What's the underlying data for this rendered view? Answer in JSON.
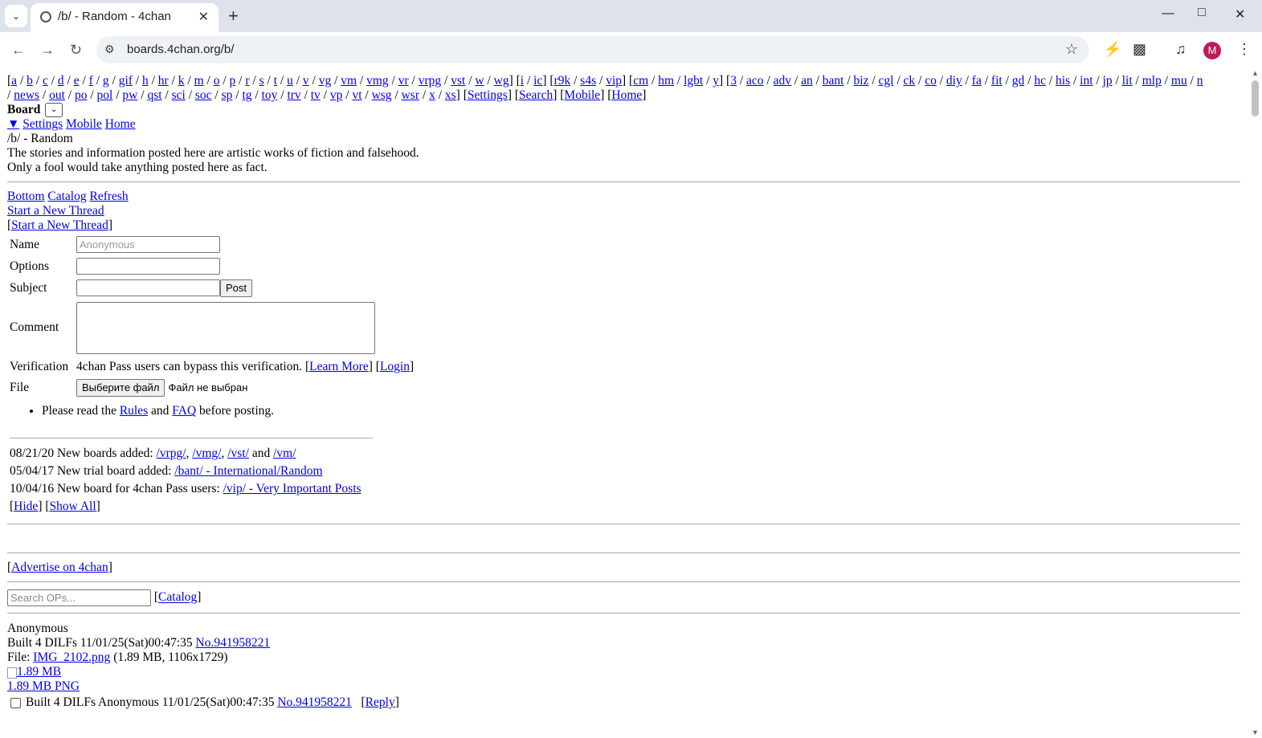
{
  "browser": {
    "tab_title": "/b/ - Random - 4chan",
    "url": "boards.4chan.org/b/",
    "avatar_letter": "M"
  },
  "boardnav": {
    "line1": [
      {
        "t": "[",
        "l": false
      },
      {
        "t": "a",
        "l": true
      },
      {
        "t": " / ",
        "l": false
      },
      {
        "t": "b",
        "l": true
      },
      {
        "t": " / ",
        "l": false
      },
      {
        "t": "c",
        "l": true
      },
      {
        "t": " / ",
        "l": false
      },
      {
        "t": "d",
        "l": true
      },
      {
        "t": " / ",
        "l": false
      },
      {
        "t": "e",
        "l": true
      },
      {
        "t": " / ",
        "l": false
      },
      {
        "t": "f",
        "l": true
      },
      {
        "t": " / ",
        "l": false
      },
      {
        "t": "g",
        "l": true
      },
      {
        "t": " / ",
        "l": false
      },
      {
        "t": "gif",
        "l": true
      },
      {
        "t": " / ",
        "l": false
      },
      {
        "t": "h",
        "l": true
      },
      {
        "t": " / ",
        "l": false
      },
      {
        "t": "hr",
        "l": true
      },
      {
        "t": " / ",
        "l": false
      },
      {
        "t": "k",
        "l": true
      },
      {
        "t": " / ",
        "l": false
      },
      {
        "t": "m",
        "l": true
      },
      {
        "t": " / ",
        "l": false
      },
      {
        "t": "o",
        "l": true
      },
      {
        "t": " / ",
        "l": false
      },
      {
        "t": "p",
        "l": true
      },
      {
        "t": " / ",
        "l": false
      },
      {
        "t": "r",
        "l": true
      },
      {
        "t": " / ",
        "l": false
      },
      {
        "t": "s",
        "l": true
      },
      {
        "t": " / ",
        "l": false
      },
      {
        "t": "t",
        "l": true
      },
      {
        "t": " / ",
        "l": false
      },
      {
        "t": "u",
        "l": true
      },
      {
        "t": " / ",
        "l": false
      },
      {
        "t": "v",
        "l": true
      },
      {
        "t": " / ",
        "l": false
      },
      {
        "t": "vg",
        "l": true
      },
      {
        "t": " / ",
        "l": false
      },
      {
        "t": "vm",
        "l": true
      },
      {
        "t": " / ",
        "l": false
      },
      {
        "t": "vmg",
        "l": true
      },
      {
        "t": " / ",
        "l": false
      },
      {
        "t": "vr",
        "l": true
      },
      {
        "t": " / ",
        "l": false
      },
      {
        "t": "vrpg",
        "l": true
      },
      {
        "t": " / ",
        "l": false
      },
      {
        "t": "vst",
        "l": true
      },
      {
        "t": " / ",
        "l": false
      },
      {
        "t": "w",
        "l": true
      },
      {
        "t": " / ",
        "l": false
      },
      {
        "t": "wg",
        "l": true
      },
      {
        "t": "] [",
        "l": false
      },
      {
        "t": "i",
        "l": true
      },
      {
        "t": " / ",
        "l": false
      },
      {
        "t": "ic",
        "l": true
      },
      {
        "t": "] [",
        "l": false
      },
      {
        "t": "r9k",
        "l": true
      },
      {
        "t": " / ",
        "l": false
      },
      {
        "t": "s4s",
        "l": true
      },
      {
        "t": " / ",
        "l": false
      },
      {
        "t": "vip",
        "l": true
      },
      {
        "t": "] [",
        "l": false
      },
      {
        "t": "cm",
        "l": true
      },
      {
        "t": " / ",
        "l": false
      },
      {
        "t": "hm",
        "l": true
      },
      {
        "t": " / ",
        "l": false
      },
      {
        "t": "lgbt",
        "l": true
      },
      {
        "t": " / ",
        "l": false
      },
      {
        "t": "y",
        "l": true
      },
      {
        "t": "] [",
        "l": false
      },
      {
        "t": "3",
        "l": true
      },
      {
        "t": " / ",
        "l": false
      },
      {
        "t": "aco",
        "l": true
      },
      {
        "t": " / ",
        "l": false
      },
      {
        "t": "adv",
        "l": true
      },
      {
        "t": " / ",
        "l": false
      },
      {
        "t": "an",
        "l": true
      },
      {
        "t": " / ",
        "l": false
      },
      {
        "t": "bant",
        "l": true
      },
      {
        "t": " / ",
        "l": false
      },
      {
        "t": "biz",
        "l": true
      },
      {
        "t": " / ",
        "l": false
      },
      {
        "t": "cgl",
        "l": true
      },
      {
        "t": " / ",
        "l": false
      },
      {
        "t": "ck",
        "l": true
      },
      {
        "t": " / ",
        "l": false
      },
      {
        "t": "co",
        "l": true
      },
      {
        "t": " / ",
        "l": false
      },
      {
        "t": "diy",
        "l": true
      },
      {
        "t": " / ",
        "l": false
      },
      {
        "t": "fa",
        "l": true
      },
      {
        "t": " / ",
        "l": false
      },
      {
        "t": "fit",
        "l": true
      },
      {
        "t": " / ",
        "l": false
      },
      {
        "t": "gd",
        "l": true
      },
      {
        "t": " / ",
        "l": false
      },
      {
        "t": "hc",
        "l": true
      },
      {
        "t": " / ",
        "l": false
      },
      {
        "t": "his",
        "l": true
      },
      {
        "t": " / ",
        "l": false
      },
      {
        "t": "int",
        "l": true
      },
      {
        "t": " / ",
        "l": false
      },
      {
        "t": "jp",
        "l": true
      },
      {
        "t": " / ",
        "l": false
      },
      {
        "t": "lit",
        "l": true
      },
      {
        "t": " / ",
        "l": false
      },
      {
        "t": "mlp",
        "l": true
      },
      {
        "t": " / ",
        "l": false
      },
      {
        "t": "mu",
        "l": true
      },
      {
        "t": " / ",
        "l": false
      },
      {
        "t": "n",
        "l": true
      }
    ],
    "line2": [
      {
        "t": "/ ",
        "l": false
      },
      {
        "t": "news",
        "l": true
      },
      {
        "t": " / ",
        "l": false
      },
      {
        "t": "out",
        "l": true
      },
      {
        "t": " / ",
        "l": false
      },
      {
        "t": "po",
        "l": true
      },
      {
        "t": " / ",
        "l": false
      },
      {
        "t": "pol",
        "l": true
      },
      {
        "t": " / ",
        "l": false
      },
      {
        "t": "pw",
        "l": true
      },
      {
        "t": " / ",
        "l": false
      },
      {
        "t": "qst",
        "l": true
      },
      {
        "t": " / ",
        "l": false
      },
      {
        "t": "sci",
        "l": true
      },
      {
        "t": " / ",
        "l": false
      },
      {
        "t": "soc",
        "l": true
      },
      {
        "t": " / ",
        "l": false
      },
      {
        "t": "sp",
        "l": true
      },
      {
        "t": " / ",
        "l": false
      },
      {
        "t": "tg",
        "l": true
      },
      {
        "t": " / ",
        "l": false
      },
      {
        "t": "toy",
        "l": true
      },
      {
        "t": " / ",
        "l": false
      },
      {
        "t": "trv",
        "l": true
      },
      {
        "t": " / ",
        "l": false
      },
      {
        "t": "tv",
        "l": true
      },
      {
        "t": " / ",
        "l": false
      },
      {
        "t": "vp",
        "l": true
      },
      {
        "t": " / ",
        "l": false
      },
      {
        "t": "vt",
        "l": true
      },
      {
        "t": " / ",
        "l": false
      },
      {
        "t": "wsg",
        "l": true
      },
      {
        "t": " / ",
        "l": false
      },
      {
        "t": "wsr",
        "l": true
      },
      {
        "t": " / ",
        "l": false
      },
      {
        "t": "x",
        "l": true
      },
      {
        "t": " / ",
        "l": false
      },
      {
        "t": "xs",
        "l": true
      },
      {
        "t": "] [",
        "l": false
      },
      {
        "t": "Settings",
        "l": true
      },
      {
        "t": "] [",
        "l": false
      },
      {
        "t": "Search",
        "l": true
      },
      {
        "t": "] [",
        "l": false
      },
      {
        "t": "Mobile",
        "l": true
      },
      {
        "t": "] [",
        "l": false
      },
      {
        "t": "Home",
        "l": true
      },
      {
        "t": "]",
        "l": false
      }
    ]
  },
  "board_select": {
    "label": "Board",
    "arrow": "⌄"
  },
  "mobile_links": {
    "toggle": "▼",
    "settings": "Settings",
    "mobile": "Mobile",
    "home": "Home"
  },
  "board": {
    "title": "/b/ - Random",
    "subtitle_1": "The stories and information posted here are artistic works of fiction and falsehood.",
    "subtitle_2": "Only a fool would take anything posted here as fact."
  },
  "top_links": {
    "bottom": "Bottom",
    "catalog": "Catalog",
    "refresh": "Refresh"
  },
  "new_thread": {
    "link": "Start a New Thread",
    "bracket_link": "Start a New Thread"
  },
  "form": {
    "name_label": "Name",
    "name_placeholder": "Anonymous",
    "options_label": "Options",
    "subject_label": "Subject",
    "post_button": "Post",
    "comment_label": "Comment",
    "verification_label": "Verification",
    "verification_text": "4chan Pass users can bypass this verification.",
    "learn_more": "Learn More",
    "login": "Login",
    "file_label": "File",
    "file_button": "Выберите файл",
    "file_status": "Файл не выбран",
    "rules_pre": "Please read the ",
    "rules_link": "Rules",
    "rules_mid": " and ",
    "faq_link": "FAQ",
    "rules_post": " before posting."
  },
  "news": {
    "item1_date": "08/21/20 New boards added: ",
    "item1_links": [
      "/vrpg/",
      "/vmg/",
      "/vst/",
      "/vm/"
    ],
    "item2_date": "05/04/17 New trial board added: ",
    "item2_link": "/bant/ - International/Random",
    "item3_date": "10/04/16 New board for 4chan Pass users: ",
    "item3_link": "/vip/ - Very Important Posts",
    "hide": "Hide",
    "show_all": "Show All"
  },
  "advertise": "Advertise on 4chan",
  "search": {
    "placeholder": "Search OPs...",
    "catalog": "Catalog"
  },
  "thread": {
    "name": "Anonymous",
    "subject": "Built 4 DILFs",
    "datetime": "11/01/25(Sat)00:47:35",
    "post_no": "No.941958221",
    "file_label": "File: ",
    "file_name": "IMG_2102.png",
    "file_meta": "(1.89 MB, 1106x1729)",
    "thumb_alt": "1.89 MB",
    "thumb_caption": "1.89 MB PNG",
    "reply": "Reply"
  }
}
